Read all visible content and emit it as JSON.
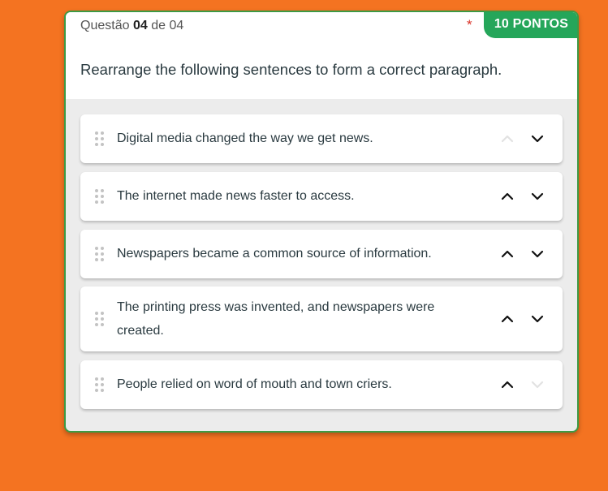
{
  "question": {
    "prefix": "Questão",
    "number": "04",
    "separator": "de",
    "total": "04",
    "required_marker": "*",
    "points": "10 PONTOS",
    "prompt": "Rearrange the following sentences to form a correct paragraph."
  },
  "items": [
    {
      "text": "Digital media changed the way we get news.",
      "up_enabled": false,
      "down_enabled": true
    },
    {
      "text": "The internet made news faster to access.",
      "up_enabled": true,
      "down_enabled": true
    },
    {
      "text": "Newspapers became a common source of information.",
      "up_enabled": true,
      "down_enabled": true
    },
    {
      "text": "The printing press was invented, and newspapers were created.",
      "up_enabled": true,
      "down_enabled": true
    },
    {
      "text": "People relied on word of mouth and town criers.",
      "up_enabled": true,
      "down_enabled": false
    }
  ],
  "colors": {
    "background": "#f47321",
    "card_border": "#3d9a44",
    "badge": "#25a65a",
    "required": "#d93025"
  },
  "icons": {
    "drag": "drag-handle-icon",
    "up": "chevron-up-icon",
    "down": "chevron-down-icon"
  }
}
